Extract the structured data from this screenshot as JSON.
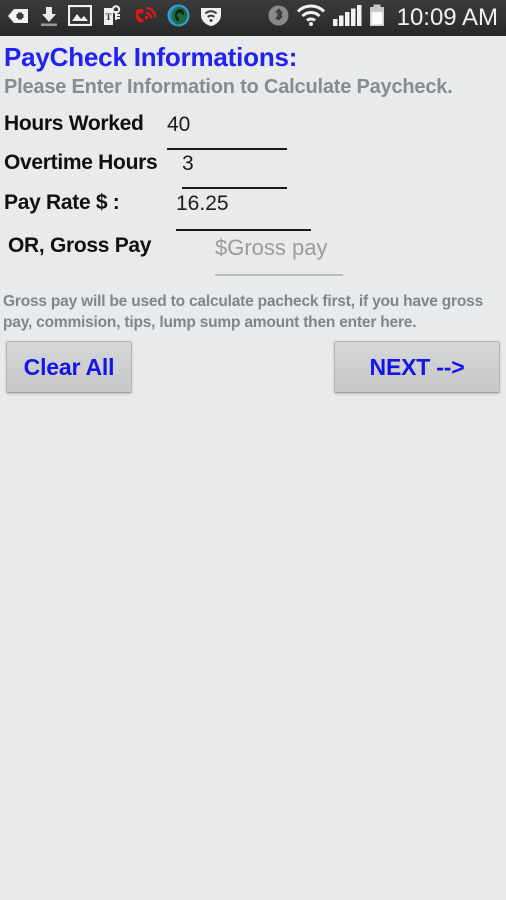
{
  "status_bar": {
    "icons_left": [
      {
        "name": "pharmacy-plus-icon",
        "label": "pharmacy-plus"
      },
      {
        "name": "download-icon",
        "label": "download"
      },
      {
        "name": "image-icon",
        "label": "image"
      },
      {
        "name": "text-tag-icon",
        "label": "text-tag"
      },
      {
        "name": "red-phone-signal-icon",
        "label": "phone-signal"
      },
      {
        "name": "globe-ear-icon",
        "label": "globe-ear"
      },
      {
        "name": "shield-wifi-icon",
        "label": "shield-wifi"
      }
    ],
    "icons_right": [
      {
        "name": "bluetooth-icon",
        "label": "bluetooth"
      },
      {
        "name": "wifi-icon",
        "label": "wifi"
      },
      {
        "name": "cellular-signal-icon",
        "label": "cellular-signal"
      },
      {
        "name": "battery-icon",
        "label": "battery"
      }
    ],
    "clock": "10:09 AM",
    "background_color": "#323232",
    "text_color": "#f2f2f2"
  },
  "page": {
    "title": "PayCheck Informations:",
    "subtitle": "Please Enter Information to Calculate Paycheck.",
    "title_color": "#2222ee",
    "subtitle_color": "#868d90",
    "background_color": "#e8eaeb"
  },
  "form": {
    "rows": [
      {
        "label": "Hours Worked",
        "value": "40",
        "placeholder": "",
        "is_placeholder": false
      },
      {
        "label": "Overtime Hours",
        "value": "3",
        "placeholder": "",
        "is_placeholder": false
      },
      {
        "label": "Pay Rate $ :",
        "value": "16.25",
        "placeholder": "",
        "is_placeholder": false
      },
      {
        "label": "OR, Gross Pay",
        "value": "",
        "placeholder": "$Gross pay",
        "is_placeholder": true
      }
    ]
  },
  "note": "Gross pay will be used to calculate pacheck first, if you have gross pay, commision, tips, lump sump amount then enter here.",
  "buttons": {
    "clear_all": "Clear All",
    "next": "NEXT -->",
    "text_color": "#1515e8",
    "background_color": "#cdcfd0"
  }
}
